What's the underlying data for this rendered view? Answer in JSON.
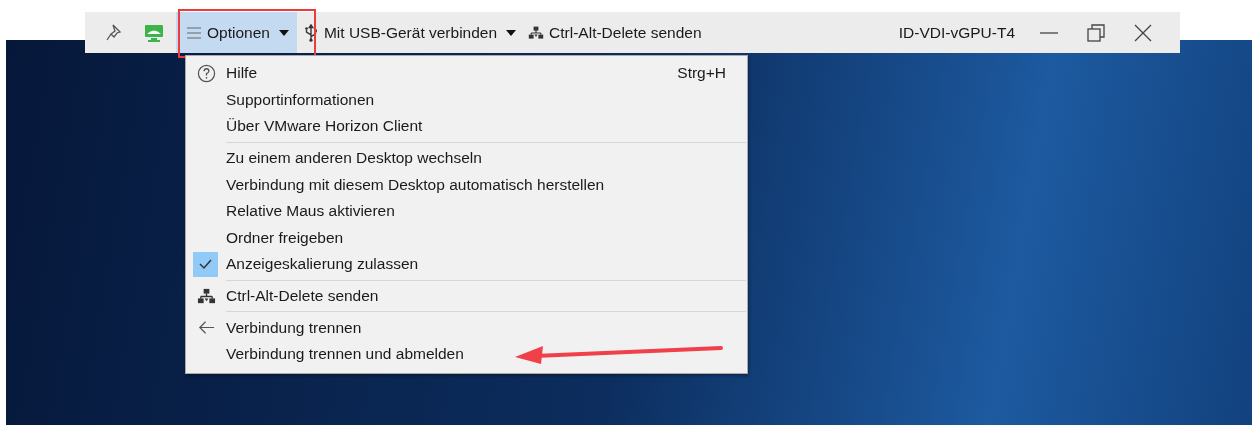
{
  "toolbar": {
    "buttons": [
      {
        "kind": "menu",
        "label": "Optionen",
        "selected": true,
        "dropdown": true
      },
      {
        "kind": "usb",
        "label": "Mit USB-Gerät verbinden",
        "selected": false,
        "dropdown": true
      },
      {
        "kind": "ctrl_alt_del",
        "label": "Ctrl-Alt-Delete senden",
        "selected": false,
        "dropdown": false
      }
    ],
    "title": "ID-VDI-vGPU-T4"
  },
  "menu": {
    "groups": [
      [
        {
          "kind": "help",
          "label": "Hilfe",
          "shortcut": "Strg+H",
          "checked": false
        },
        {
          "kind": "plain",
          "label": "Supportinformationen",
          "checked": false
        },
        {
          "kind": "plain",
          "label": "Über VMware Horizon Client",
          "checked": false
        }
      ],
      [
        {
          "kind": "plain",
          "label": "Zu einem anderen Desktop wechseln",
          "checked": false
        },
        {
          "kind": "plain",
          "label": "Verbindung mit diesem Desktop automatisch herstellen",
          "checked": false
        },
        {
          "kind": "plain",
          "label": "Relative Maus aktivieren",
          "checked": false
        },
        {
          "kind": "plain",
          "label": "Ordner freigeben",
          "checked": false
        },
        {
          "kind": "plain",
          "label": "Anzeigeskalierung zulassen",
          "checked": true
        }
      ],
      [
        {
          "kind": "ctrl_alt_del",
          "label": "Ctrl-Alt-Delete senden",
          "checked": false
        }
      ],
      [
        {
          "kind": "disconnect",
          "label": "Verbindung trennen",
          "checked": false
        },
        {
          "kind": "plain",
          "label": "Verbindung trennen und abmelden",
          "checked": false
        }
      ]
    ]
  }
}
